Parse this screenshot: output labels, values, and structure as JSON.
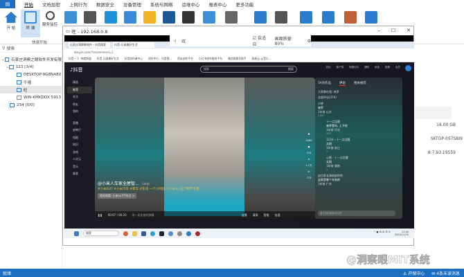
{
  "menubar": {
    "file_icon": "file-menu-icon",
    "tabs": [
      "开始",
      "文档加密",
      "上网行为",
      "数据安全",
      "设备管理",
      "系统与网络",
      "运维中心",
      "报表中心",
      "更多功能"
    ],
    "active": "开始"
  },
  "ribbon": {
    "buttons": [
      {
        "label": "开 始",
        "icon": "home-icon",
        "color": "#2a7ccd"
      },
      {
        "label": "终 端",
        "icon": "monitor-icon",
        "color": "#3a8ad6"
      },
      {
        "label": "服务监控",
        "icon": "search-icon",
        "color": "#444"
      }
    ],
    "group_label": "快速开始",
    "more_icons": [
      {
        "icon": "chart-doc-icon",
        "color": "#3c8fd8"
      },
      {
        "icon": "checklist-icon",
        "color": "#555"
      },
      {
        "icon": "desktop-icon",
        "color": "#1f8fd6"
      },
      {
        "icon": "network-icon",
        "color": "#3a8ad6"
      },
      {
        "icon": "usb-icon",
        "color": "#f0b526"
      },
      {
        "icon": "hexagon-icon",
        "color": "#1a5a9a"
      },
      {
        "icon": "server-icon",
        "color": "#333"
      },
      {
        "icon": "document-transfer-icon",
        "color": "#3c8fd8"
      },
      {
        "icon": "screen-icon",
        "color": "#666"
      },
      {
        "icon": "download-icon",
        "color": "#2a7ccd"
      },
      {
        "icon": "gear-icon",
        "color": "#555"
      },
      {
        "icon": "book-icon",
        "color": "#2a7ccd"
      },
      {
        "icon": "open-book-icon",
        "color": "#2a7ccd"
      },
      {
        "icon": "support-icon",
        "color": "#c0603a"
      },
      {
        "icon": "calculator-icon",
        "color": "#2a7ccd"
      }
    ]
  },
  "left": {
    "search_placeholder": "搜索",
    "tree": [
      {
        "label": "石家庄洞察之眼软件开发有限",
        "level": 0
      },
      {
        "label": "123  [3/4]",
        "level": 1
      },
      {
        "label": "DESKTOP-9G8NA80",
        "level": 2
      },
      {
        "label": "千禧",
        "level": 2
      },
      {
        "label": "旺",
        "level": 2,
        "selected": true
      },
      {
        "label": "WIN-KMKDDX 5913",
        "level": 2,
        "offline": true
      },
      {
        "label": "234  [0/0]",
        "level": 1
      }
    ]
  },
  "main": {
    "values": [
      "16.00 GB",
      "SKTOP-0S7SBI9",
      "8.7.93.19559"
    ]
  },
  "remote": {
    "title": "旺 - 192.168.0.8",
    "toolbar": {
      "name": "旺",
      "autofit_label": "自适应",
      "autofit_checked": true,
      "quality_label": "画面质量: 80%"
    },
    "browser": {
      "tabs": [
        "石家庄洞察眼软件 - 抖音搜索",
        "抖音-记录美好生活"
      ],
      "url": "douyin.com/?recommend=1",
      "bookmarks": [
        "抖音一下, 你就知道",
        "抖音-记录美好生活",
        "抖音创作者中心",
        "创作中心 - 抖音图...",
        "西瓜创作平台",
        "小红书创作服务平台",
        "微信视频号助手",
        "网易云-云音乐..."
      ]
    },
    "douyin": {
      "logo": "抖音",
      "search_placeholder": "搜索",
      "search_button": "搜索",
      "top_icons": [
        "充钻",
        "客户端",
        "快捷访问",
        "通知",
        "私信",
        "投稿",
        "会员"
      ],
      "nav": [
        "精选",
        "推荐",
        "关注",
        "朋友",
        "我的",
        "直播",
        "放映厅",
        "短剧",
        "知识",
        "游戏",
        "二次元",
        "音乐",
        "美食"
      ],
      "nav_selected": "推荐",
      "video": {
        "author": "@小米人车家全屋智...",
        "time": "· 1年前",
        "desc": "#小米SU7 #小米汽车 #新车 #车内 一个小时后 #小米su7这个细节不错",
        "related": "相关搜索: 小米su7汽车主 >",
        "progress": "00:07 / 00:20",
        "danmaku_placeholder": "发一条友善的弹幕",
        "controls": [
          "连播",
          "清屏",
          "智能",
          "倍速"
        ]
      },
      "side_counts": [
        "5290",
        "374",
        "1.7万",
        "773"
      ],
      "comments": {
        "tabs": [
          "TA的作品",
          "评论",
          "相关推荐"
        ],
        "active_tab": "评论",
        "hint": "大家都在搜: 林罗",
        "count": "全部评论(374)",
        "items": [
          {
            "user": "小钟",
            "text": "林罗",
            "meta": "1年前·山东",
            "likes": "2187"
          },
          {
            "user": "十一点没醒",
            "text": "林罗是吗, 上下吧",
            "meta": "1年前·河北",
            "likes": "105"
          },
          {
            "user": "1234 › 十一点没醒",
            "text": "太阳",
            "meta": "1年前·浙江",
            "likes": "2"
          },
          {
            "user": "心情 · 十一点没醒",
            "text": "太阳",
            "meta": "1年前·湖南",
            "likes": "1"
          },
          {
            "user": "这位家长请收起你的",
            "text": "这款是哪个车系的",
            "meta": "1年前·广东",
            "likes": ""
          }
        ],
        "input_placeholder": "留下你的精彩评论吧"
      }
    },
    "taskbar": {
      "search": "搜索",
      "clock_time": "11:40",
      "clock_date": "2024/11/25"
    }
  },
  "statusbar": {
    "left": "就绪",
    "right": [
      "开保中心",
      "4条未读消息"
    ]
  },
  "watermark": "@洞察眼MIT系统"
}
